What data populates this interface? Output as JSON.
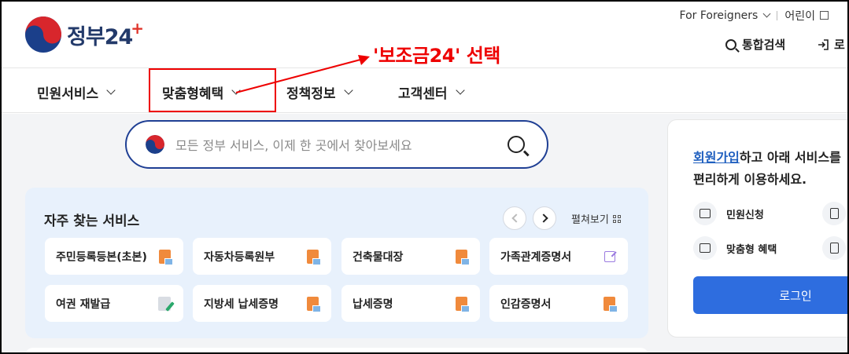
{
  "logo": {
    "name": "정부",
    "num": "24",
    "plus": "+"
  },
  "top_util": {
    "foreigners": "For Foreigners",
    "kids": "어린이"
  },
  "header": {
    "search_label": "통합검색",
    "login_label": "로"
  },
  "nav": {
    "items": [
      "민원서비스",
      "맞춤형혜택",
      "정책정보",
      "고객센터"
    ]
  },
  "annotation": {
    "text": "'보조금24' 선택",
    "color": "#ee0000"
  },
  "search": {
    "placeholder": "모든 정부 서비스, 이제 한 곳에서 찾아보세요"
  },
  "favorites": {
    "title": "자주 찾는 서비스",
    "expand_label": "펼쳐보기",
    "items": [
      {
        "label": "주민등록등본(초본)",
        "icon": "document-icon"
      },
      {
        "label": "자동차등록원부",
        "icon": "document-icon"
      },
      {
        "label": "건축물대장",
        "icon": "document-icon"
      },
      {
        "label": "가족관계증명서",
        "icon": "external-link-icon"
      },
      {
        "label": "여권 재발급",
        "icon": "edit-icon"
      },
      {
        "label": "지방세 납세증명",
        "icon": "document-icon"
      },
      {
        "label": "납세증명",
        "icon": "document-icon"
      },
      {
        "label": "인감증명서",
        "icon": "document-icon"
      }
    ]
  },
  "login_panel": {
    "signup_link": "회원가입",
    "line1_rest": "하고 아래 서비스를",
    "line2": "편리하게 이용하세요.",
    "items": [
      "민원신청",
      "맞춤형 혜택"
    ],
    "login_button": "로그인"
  },
  "colors": {
    "brand_navy": "#233a6a",
    "primary_blue": "#2e6ddf",
    "accent_red": "#e0352b"
  }
}
